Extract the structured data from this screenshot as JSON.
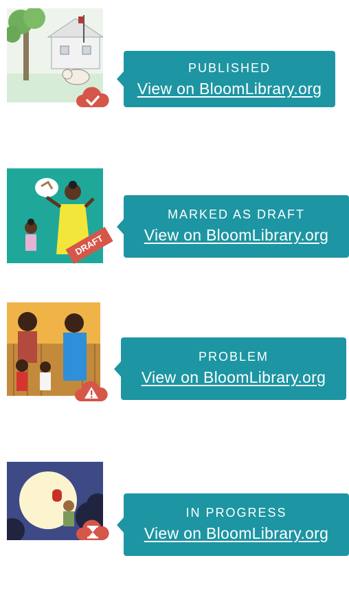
{
  "items": [
    {
      "status": "PUBLISHED",
      "link": "View on BloomLibrary.org",
      "badge": "cloud-check-icon"
    },
    {
      "status": "MARKED AS DRAFT",
      "link": "View on BloomLibrary.org",
      "badge": "draft-ribbon",
      "ribbon_text": "DRAFT"
    },
    {
      "status": "PROBLEM",
      "link": "View on BloomLibrary.org",
      "badge": "cloud-warning-icon"
    },
    {
      "status": "IN PROGRESS",
      "link": "View on BloomLibrary.org",
      "badge": "cloud-hourglass-icon"
    }
  ],
  "colors": {
    "bubble": "#1d95a3",
    "badge": "#d65649",
    "text": "#ffffff"
  }
}
